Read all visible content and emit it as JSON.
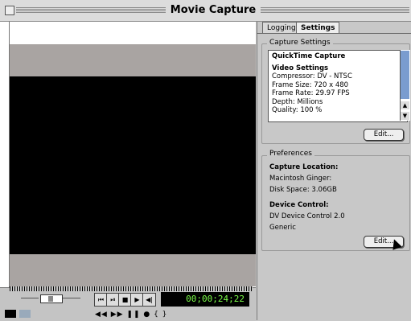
{
  "window": {
    "title": "Movie Capture"
  },
  "tabs": [
    {
      "label": "Logging",
      "selected": false
    },
    {
      "label": "Settings",
      "selected": true
    }
  ],
  "capture_settings": {
    "legend": "Capture Settings",
    "heading": "QuickTime Capture",
    "video_heading": "Video Settings",
    "lines": [
      "Compressor: DV - NTSC",
      "Frame Size: 720 x 480",
      "Frame Rate: 29.97 FPS",
      "Depth: Millions",
      "Quality: 100 %"
    ],
    "edit_label": "Edit..."
  },
  "preferences": {
    "legend": "Preferences",
    "capture_location_heading": "Capture Location:",
    "drive": "Macintosh Ginger:",
    "disk_space": "Disk Space: 3.06GB",
    "device_control_heading": "Device Control:",
    "device": "DV Device Control 2.0",
    "device_type": "Generic",
    "edit_label": "Edit..."
  },
  "transport": {
    "timecode": "00;00;24;22",
    "buttons": [
      "⏮",
      "⏯",
      "■",
      "▶",
      "◀|",
      "|▶"
    ],
    "bottom_row": "◀◀  ▶▶  ❚❚  ●  {  }"
  },
  "colors": {
    "timecode_text": "#7dff4a",
    "scroll_thumb": "#7a9ccf",
    "video_bg": "#000000"
  }
}
